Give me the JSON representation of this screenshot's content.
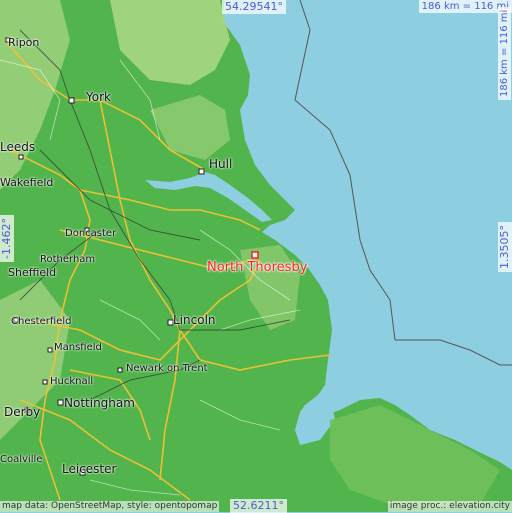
{
  "map": {
    "coords": {
      "top": "54.29541°",
      "bottom": "52.6211°",
      "left": "-1.462°",
      "right": "1.3505°"
    },
    "scale_top": "186 km = 116 mi",
    "scale_right": "186 km = 116 mi",
    "attribution": "map data: OpenStreetMap, style: opentopomap",
    "credit": "image proc.: elevation.city",
    "highlight": {
      "name": "North Thoresby",
      "color": "#ff2020"
    },
    "colors": {
      "sea": "#8dcfe0",
      "land": "#4fb34a",
      "highland": "#9ccf7c"
    },
    "cities": [
      {
        "name": "Ripon"
      },
      {
        "name": "York"
      },
      {
        "name": "Leeds"
      },
      {
        "name": "Hull"
      },
      {
        "name": "Wakefield"
      },
      {
        "name": "Doncaster"
      },
      {
        "name": "Rotherham"
      },
      {
        "name": "Sheffield"
      },
      {
        "name": "Chesterfield"
      },
      {
        "name": "Lincoln"
      },
      {
        "name": "Mansfield"
      },
      {
        "name": "Newark on Trent"
      },
      {
        "name": "Hucknall"
      },
      {
        "name": "Nottingham"
      },
      {
        "name": "Derby"
      },
      {
        "name": "Coalville"
      },
      {
        "name": "Leicester"
      }
    ]
  }
}
